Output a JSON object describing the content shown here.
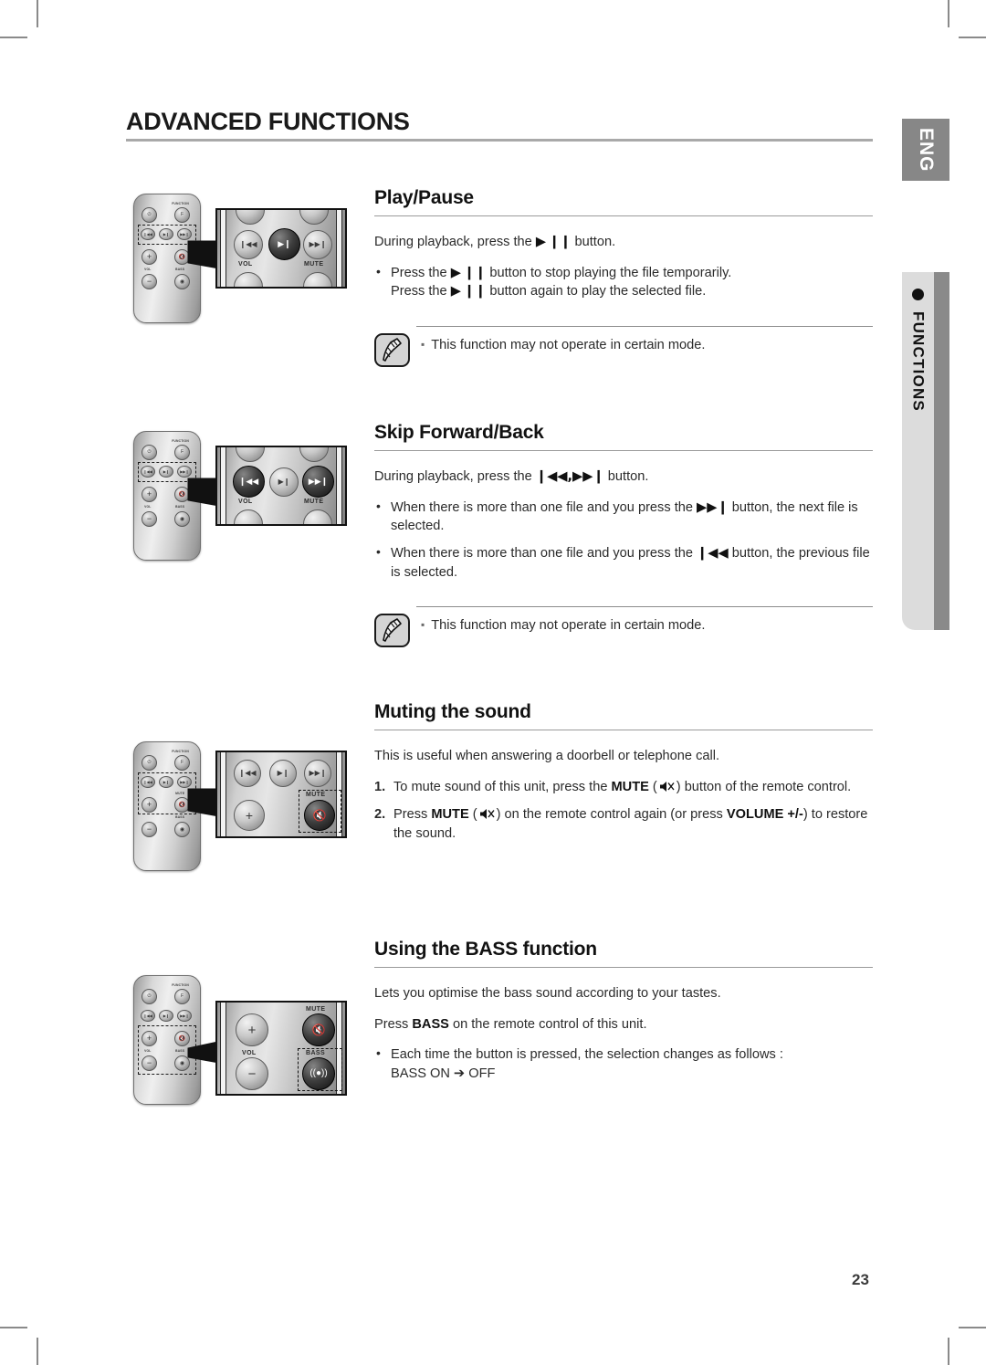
{
  "page": {
    "title": "ADVANCED FUNCTIONS",
    "number": "23"
  },
  "side_tabs": {
    "language": "ENG",
    "section": "FUNCTIONS"
  },
  "sections": [
    {
      "id": "play-pause",
      "heading": "Play/Pause",
      "intro": "During playback, press the ▶❙❙ button.",
      "intro_parts": {
        "pre": "During playback, press the ",
        "icon": "▶ ❙❙",
        "post": " button."
      },
      "bullets": [
        "Press the ▶❙❙ button to stop playing the file temporarily. Press the ▶❙❙ button again to play the selected file."
      ],
      "note": "This function may not operate in certain mode."
    },
    {
      "id": "skip-forward-back",
      "heading": "Skip Forward/Back",
      "intro_parts": {
        "pre": "During playback, press the ",
        "icon": "❙◀◀,▶▶❙",
        "post": " button."
      },
      "bullets": [
        "When there is more than one file and you press the ▶▶❙ button, the next file is selected.",
        "When there is more than one file and you press the ❙◀◀ button, the previous file is selected."
      ],
      "note": "This function may not operate in certain mode."
    },
    {
      "id": "muting-the-sound",
      "heading": "Muting the sound",
      "intro": "This is useful when answering a doorbell or telephone call.",
      "steps": [
        {
          "num": "1.",
          "pre": "To mute sound of this unit, press the ",
          "bold": "MUTE",
          "mid": " (",
          "icon": "mute-icon",
          "post": ") button of the remote control."
        },
        {
          "num": "2.",
          "pre": "Press ",
          "bold": "MUTE",
          "mid": " (",
          "icon": "mute-icon",
          "post": ") on the remote control again (or press ",
          "bold2": "VOLUME +/-",
          "post2": ") to restore the sound."
        }
      ]
    },
    {
      "id": "using-the-bass-function",
      "heading": "Using the BASS function",
      "intro": "Lets you optimise the bass sound according to your tastes.",
      "intro2_parts": {
        "pre": "Press ",
        "bold": "BASS",
        "post": " on the remote control of this unit."
      },
      "bullets": [
        "Each time the button is pressed, the selection changes as follows : BASS ON ➔ OFF"
      ],
      "bullet_line1": "Each time the button is pressed, the selection changes as follows :",
      "bullet_line2": "BASS ON ➔ OFF"
    }
  ],
  "remote": {
    "buttons": {
      "power": "⏻",
      "function": "F",
      "skip_back": "❙◀◀",
      "play_pause": "▶❙❙",
      "skip_fwd": "▶▶❙",
      "vol_up": "+",
      "vol_down": "−",
      "mute": "mute-icon",
      "bass": "bass-icon"
    },
    "labels": {
      "function": "FUNCTION",
      "vol": "VOL",
      "mute": "MUTE",
      "bass": "BASS"
    }
  },
  "figures": [
    {
      "id": "figure-play-pause",
      "highlight": "play_pause",
      "mag_labels": [
        "VOL",
        "MUTE"
      ]
    },
    {
      "id": "figure-skip",
      "highlight": "skip",
      "mag_labels": [
        "VOL",
        "MUTE"
      ]
    },
    {
      "id": "figure-mute",
      "highlight": "mute",
      "mag_labels": [
        "MUTE"
      ]
    },
    {
      "id": "figure-bass",
      "highlight": "bass",
      "mag_labels": [
        "VOL",
        "MUTE",
        "BASS"
      ]
    }
  ],
  "colors": {
    "rule": "#9a9a9a",
    "tab_gray": "#878787",
    "tab_light": "#dcdcdc",
    "text": "#2a2a2a"
  }
}
